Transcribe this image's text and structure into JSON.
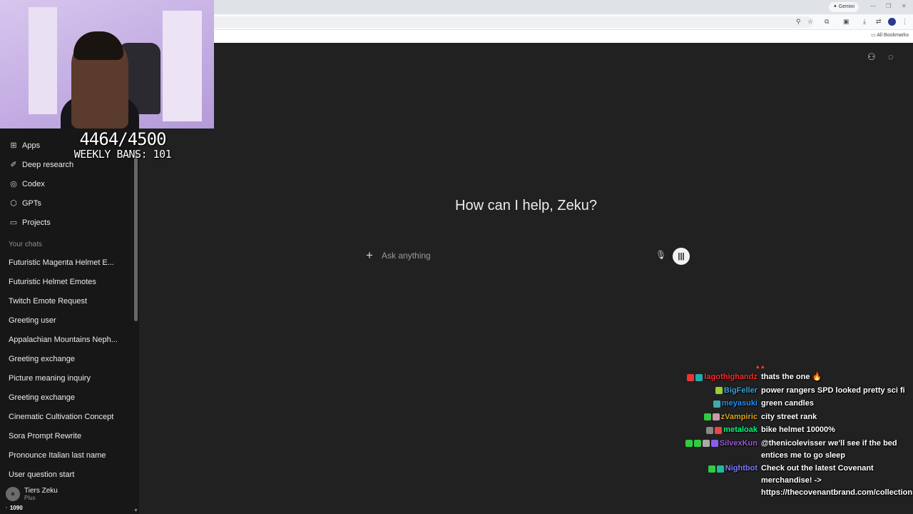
{
  "browser": {
    "gemini_label": "✦ Gemini",
    "bookmarks_label": "All Bookmarks"
  },
  "overlay": {
    "counter": "4464/4500",
    "weekly_bans": "WEEKLY BANS: 101"
  },
  "sidebar": {
    "nav": [
      {
        "icon": "apps-icon",
        "glyph": "⊞",
        "label": "Apps"
      },
      {
        "icon": "telescope-icon",
        "glyph": "✐",
        "label": "Deep research"
      },
      {
        "icon": "codex-icon",
        "glyph": "◎",
        "label": "Codex"
      },
      {
        "icon": "cube-icon",
        "glyph": "⬡",
        "label": "GPTs"
      },
      {
        "icon": "folder-icon",
        "glyph": "▭",
        "label": "Projects"
      }
    ],
    "chats_label": "Your chats",
    "chats": [
      "Futuristic Magenta Helmet E...",
      "Futuristic Helmet Emotes",
      "Twitch Emote Request",
      "Greeting user",
      "Appalachian Mountains Neph...",
      "Greeting exchange",
      "Picture meaning inquiry",
      "Greeting exchange",
      "Cinematic Cultivation Concept",
      "Sora Prompt Rewrite",
      "Pronounce Italian last name",
      "User question start"
    ],
    "user": {
      "name": "Tiers Zeku",
      "plan": "Plus"
    },
    "viewers": "1090"
  },
  "main": {
    "headline": "How can I help, Zeku?",
    "composer": {
      "placeholder": "Ask anything"
    }
  },
  "chat": {
    "messages": [
      {
        "user": "lagothighandz",
        "color": "#ff2b2b",
        "badges": [
          "#e33",
          "#2aa"
        ],
        "text": "thats the one 🔥"
      },
      {
        "user": "BigFeller",
        "color": "#3b9fd6",
        "badges": [
          "#9acd32"
        ],
        "text": "power rangers SPD looked pretty sci fi"
      },
      {
        "user": "meyasuki",
        "color": "#1e90ff",
        "badges": [
          "#4aa"
        ],
        "text": "green candles"
      },
      {
        "user": "zVampiric",
        "color": "#daa520",
        "badges": [
          "#2ecc40",
          "#c9a"
        ],
        "text": "city street rank"
      },
      {
        "user": "metaloak",
        "color": "#00ff7f",
        "badges": [
          "#888",
          "#e44"
        ],
        "text": "bike helmet 10000%"
      },
      {
        "user": "SilvexKun",
        "color": "#9b59d0",
        "badges": [
          "#2ecc40",
          "#2ecc40",
          "#aaa",
          "#8a5cf0"
        ],
        "text": "@thenicolevisser we'll see if the bed entices me to go sleep"
      },
      {
        "user": "Nightbot",
        "color": "#7c7cff",
        "badges": [
          "#2ecc40",
          "#1abc9c"
        ],
        "text": "Check out the latest Covenant merchandise! -> https://thecovenantbrand.com/collections/all"
      }
    ]
  }
}
